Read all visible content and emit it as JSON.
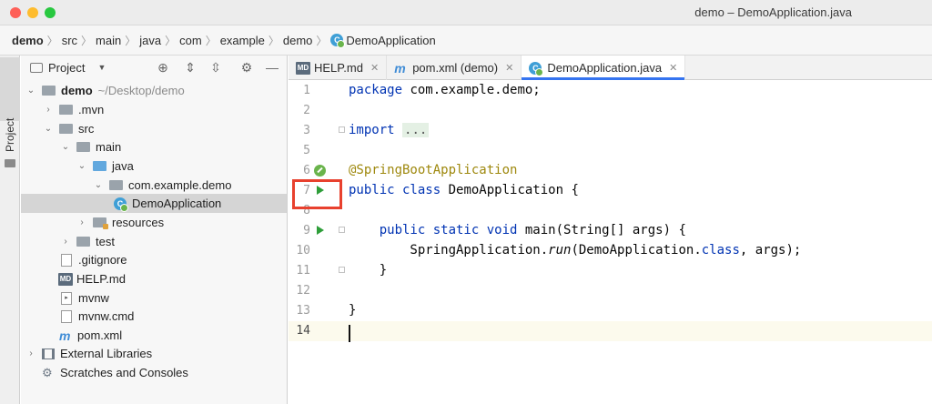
{
  "window": {
    "title": "demo – DemoApplication.java"
  },
  "breadcrumb": [
    "demo",
    "src",
    "main",
    "java",
    "com",
    "example",
    "demo",
    "DemoApplication"
  ],
  "sidestrip": {
    "tab_label": "Project"
  },
  "project_panel": {
    "title": "Project",
    "tree": [
      {
        "label": "demo",
        "path": "~/Desktop/demo",
        "arrow": "open",
        "icon": "folder-gray",
        "indent": 0,
        "bold": true
      },
      {
        "label": ".mvn",
        "arrow": "closed",
        "icon": "folder-gray",
        "indent": 1
      },
      {
        "label": "src",
        "arrow": "open",
        "icon": "folder-gray",
        "indent": 1
      },
      {
        "label": "main",
        "arrow": "open",
        "icon": "folder-gray",
        "indent": 2
      },
      {
        "label": "java",
        "arrow": "open",
        "icon": "folder-blue",
        "indent": 3
      },
      {
        "label": "com.example.demo",
        "arrow": "open",
        "icon": "folder-gray",
        "indent": 4
      },
      {
        "label": "DemoApplication",
        "arrow": "none",
        "icon": "spring-class-icon",
        "indent": 5,
        "selected": true
      },
      {
        "label": "resources",
        "arrow": "closed",
        "icon": "folder-resources",
        "indent": 3
      },
      {
        "label": "test",
        "arrow": "closed",
        "icon": "folder-gray",
        "indent": 2
      },
      {
        "label": ".gitignore",
        "arrow": "none",
        "icon": "text-file-icon",
        "indent": 1
      },
      {
        "label": "HELP.md",
        "arrow": "none",
        "icon": "markdown-icon",
        "indent": 1
      },
      {
        "label": "mvnw",
        "arrow": "none",
        "icon": "shell-file-icon",
        "indent": 1
      },
      {
        "label": "mvnw.cmd",
        "arrow": "none",
        "icon": "text-file-icon",
        "indent": 1
      },
      {
        "label": "pom.xml",
        "arrow": "none",
        "icon": "maven-icon",
        "indent": 1
      },
      {
        "label": "External Libraries",
        "arrow": "closed",
        "icon": "library-icon",
        "indent": 0
      },
      {
        "label": "Scratches and Consoles",
        "arrow": "none",
        "icon": "scratch-icon",
        "indent": 0
      }
    ]
  },
  "tabs": [
    {
      "label": "HELP.md",
      "icon": "markdown-icon",
      "active": false
    },
    {
      "label": "pom.xml (demo)",
      "icon": "maven-icon",
      "active": false
    },
    {
      "label": "DemoApplication.java",
      "icon": "spring-class-icon",
      "active": true
    }
  ],
  "editor": {
    "lines": [
      {
        "n": "1",
        "code": "package com.example.demo;"
      },
      {
        "n": "2",
        "code": ""
      },
      {
        "n": "3",
        "code": "import ..."
      },
      {
        "n": "5",
        "code": ""
      },
      {
        "n": "6",
        "code": "@SpringBootApplication"
      },
      {
        "n": "7",
        "code": "public class DemoApplication {"
      },
      {
        "n": "8",
        "code": ""
      },
      {
        "n": "9",
        "code": "    public static void main(String[] args) {"
      },
      {
        "n": "10",
        "code": "        SpringApplication.run(DemoApplication.class, args);"
      },
      {
        "n": "11",
        "code": "    }"
      },
      {
        "n": "12",
        "code": ""
      },
      {
        "n": "13",
        "code": "}"
      },
      {
        "n": "14",
        "code": ""
      }
    ]
  },
  "colors": {
    "keyword": "#0033b3",
    "annotation": "#9e880d",
    "run_gutter": "#2e9e39",
    "highlight_box": "#e8412e",
    "active_tab_underline": "#3574f0"
  }
}
